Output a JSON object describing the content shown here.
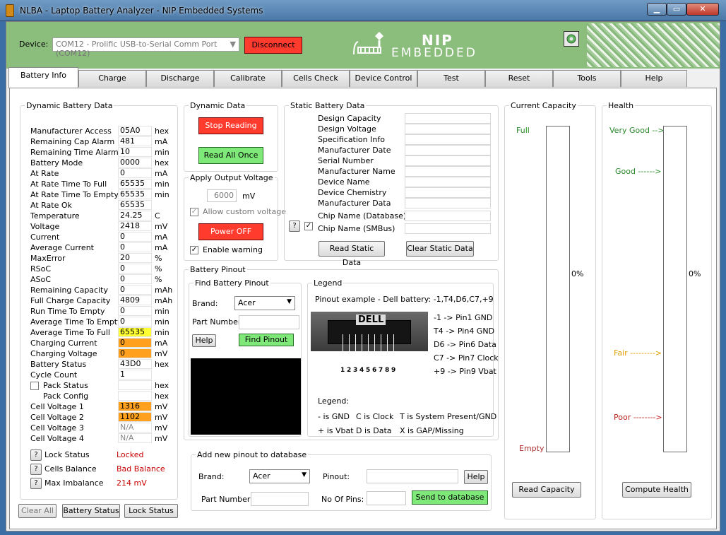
{
  "window": {
    "title": "NLBA - Laptop Battery Analyzer - NIP Embedded Systems",
    "min_glyph": "▁",
    "max_glyph": "▭",
    "close_glyph": "✕"
  },
  "header": {
    "device_label": "Device:",
    "device_value": "COM12 - Prolific USB-to-Serial Comm Port (COM12)",
    "disconnect_label": "Disconnect",
    "logo_line1": "NIP",
    "logo_line2": "EMBEDDED"
  },
  "tabs": [
    "Battery Info",
    "Charge",
    "Discharge",
    "Calibrate",
    "Cells Check",
    "Device Control",
    "Test",
    "Reset",
    "Tools",
    "Help"
  ],
  "dynamic": {
    "title": "Dynamic Battery Data",
    "rows": [
      {
        "label": "Manufacturer Access",
        "value": "05A0",
        "unit": "hex"
      },
      {
        "label": "Remaining Cap Alarm",
        "value": "481",
        "unit": "mA"
      },
      {
        "label": "Remaining Time Alarm",
        "value": "10",
        "unit": "min"
      },
      {
        "label": "Battery Mode",
        "value": "0000",
        "unit": "hex"
      },
      {
        "label": "At Rate",
        "value": "0",
        "unit": "mA"
      },
      {
        "label": "At Rate Time To Full",
        "value": "65535",
        "unit": "min"
      },
      {
        "label": "At Rate Time To Empty",
        "value": "65535",
        "unit": "min"
      },
      {
        "label": "At Rate Ok",
        "value": "65535",
        "unit": ""
      },
      {
        "label": "Temperature",
        "value": "24.25",
        "unit": "C"
      },
      {
        "label": "Voltage",
        "value": "2418",
        "unit": "mV"
      },
      {
        "label": "Current",
        "value": "0",
        "unit": "mA"
      },
      {
        "label": "Average Current",
        "value": "0",
        "unit": "mA"
      },
      {
        "label": "MaxError",
        "value": "20",
        "unit": "%"
      },
      {
        "label": "RSoC",
        "value": "0",
        "unit": "%"
      },
      {
        "label": "ASoC",
        "value": "0",
        "unit": "%"
      },
      {
        "label": "Remaining Capacity",
        "value": "0",
        "unit": "mAh"
      },
      {
        "label": "Full Charge Capacity",
        "value": "4809",
        "unit": "mAh"
      },
      {
        "label": "Run Time To Empty",
        "value": "0",
        "unit": "min"
      },
      {
        "label": "Average Time To Empty",
        "value": "0",
        "unit": "min"
      },
      {
        "label": "Average Time To Full",
        "value": "65535",
        "unit": "min",
        "hl": "yellow"
      },
      {
        "label": "Charging Current",
        "value": "0",
        "unit": "mA",
        "hl": "orange"
      },
      {
        "label": "Charging Voltage",
        "value": "0",
        "unit": "mV",
        "hl": "orange"
      },
      {
        "label": "Battery Status",
        "value": "43D0",
        "unit": "hex"
      },
      {
        "label": "Cycle Count",
        "value": "1",
        "unit": ""
      },
      {
        "label": "Pack Status",
        "value": "",
        "unit": "hex",
        "indent": true
      },
      {
        "label": "Pack Config",
        "value": "",
        "unit": "hex",
        "indent": true
      },
      {
        "label": "Cell Voltage 1",
        "value": "1316",
        "unit": "mV",
        "hl": "orange"
      },
      {
        "label": "Cell Voltage 2",
        "value": "1102",
        "unit": "mV",
        "hl": "orange"
      },
      {
        "label": "Cell Voltage 3",
        "value": "N/A",
        "unit": "mV",
        "na": true
      },
      {
        "label": "Cell Voltage 4",
        "value": "N/A",
        "unit": "mV",
        "na": true
      }
    ],
    "lock_status_label": "Lock Status",
    "lock_status_value": "Locked",
    "cells_balance_label": "Cells Balance",
    "cells_balance_value": "Bad Balance",
    "max_imbalance_label": "Max Imbalance",
    "max_imbalance_value": "214 mV",
    "question_mark": "?",
    "clear_all": "Clear All",
    "battery_status_btn": "Battery Status",
    "lock_status_btn": "Lock Status"
  },
  "dynamic_data": {
    "title": "Dynamic Data",
    "stop_reading": "Stop Reading",
    "read_all_once": "Read All Once"
  },
  "output_voltage": {
    "title": "Apply Output Voltage",
    "value": "6000",
    "unit": "mV",
    "allow_custom": "Allow custom voltage",
    "power_off": "Power OFF",
    "enable_warning": "Enable warning",
    "check_mark": "✓"
  },
  "static": {
    "title": "Static Battery Data",
    "labels": [
      "Design Capacity",
      "Design Voltage",
      "Specification Info",
      "Manufacturer Date",
      "Serial Number",
      "Manufacturer Name",
      "Device Name",
      "Device Chemistry",
      "Manufacturer Data",
      "Chip Name (Database)",
      "Chip Name (SMBus)"
    ],
    "read_btn": "Read Static Data",
    "clear_btn": "Clear Static Data"
  },
  "capacity": {
    "title": "Current Capacity",
    "full": "Full",
    "empty": "Empty",
    "percent": "0%",
    "level": 0,
    "read_btn": "Read Capacity"
  },
  "health": {
    "title": "Health",
    "very_good": "Very Good -->",
    "good": "Good ------>",
    "fair": "Fair --------->",
    "poor": "Poor -------->",
    "percent": "0%",
    "level": 0,
    "compute_btn": "Compute Health"
  },
  "pinout": {
    "title": "Battery Pinout",
    "find_title": "Find Battery Pinout",
    "brand_label": "Brand:",
    "brand_value": "Acer",
    "part_label": "Part Number:",
    "help_btn": "Help",
    "find_btn": "Find Pinout",
    "legend_title": "Legend",
    "example": "Pinout example - Dell battery:  -1,T4,D6,C7,+9",
    "dell": "DELL",
    "pin_numbers": [
      "1",
      "2",
      "3",
      "4",
      "5",
      "6",
      "7",
      "8",
      "9"
    ],
    "pin_map": [
      "-1 -> Pin1 GND",
      "T4 -> Pin4 GND",
      "D6 -> Pin6 Data",
      "C7 -> Pin7 Clock",
      "+9 -> Pin9 Vbat"
    ],
    "legend_label": "Legend:",
    "legend_items": [
      "- is GND",
      "C is Clock",
      "T is System Present/GND",
      "+ is Vbat",
      "D is Data",
      "X is GAP/Missing"
    ]
  },
  "add_pinout": {
    "title": "Add new pinout to database",
    "brand_label": "Brand:",
    "brand_value": "Acer",
    "pinout_label": "Pinout:",
    "help_btn": "Help",
    "part_label": "Part Number:",
    "pins_label": "No Of Pins:",
    "send_btn": "Send to database"
  }
}
